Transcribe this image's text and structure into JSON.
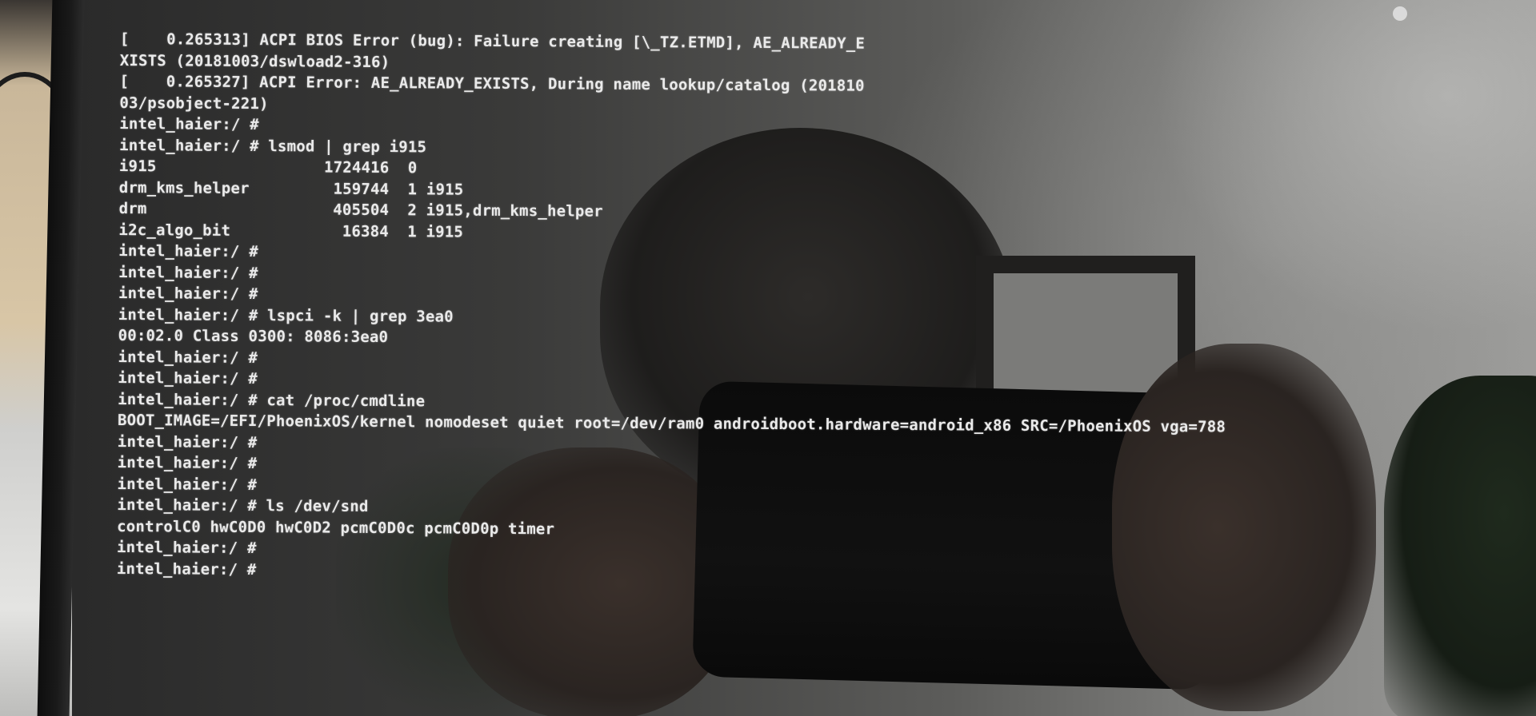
{
  "terminal": {
    "lines": [
      "[    0.265313] ACPI BIOS Error (bug): Failure creating [\\_TZ.ETMD], AE_ALREADY_E",
      "XISTS (20181003/dswload2-316)",
      "[    0.265327] ACPI Error: AE_ALREADY_EXISTS, During name lookup/catalog (201810",
      "03/psobject-221)",
      "intel_haier:/ #",
      "intel_haier:/ # lsmod | grep i915",
      "i915                  1724416  0",
      "drm_kms_helper         159744  1 i915",
      "drm                    405504  2 i915,drm_kms_helper",
      "i2c_algo_bit            16384  1 i915",
      "intel_haier:/ #",
      "intel_haier:/ #",
      "intel_haier:/ #",
      "intel_haier:/ # lspci -k | grep 3ea0",
      "00:02.0 Class 0300: 8086:3ea0",
      "intel_haier:/ #",
      "intel_haier:/ #",
      "intel_haier:/ # cat /proc/cmdline",
      "BOOT_IMAGE=/EFI/PhoenixOS/kernel nomodeset quiet root=/dev/ram0 androidboot.hardware=android_x86 SRC=/PhoenixOS vga=788",
      "intel_haier:/ #",
      "intel_haier:/ #",
      "intel_haier:/ #",
      "intel_haier:/ # ls /dev/snd",
      "controlC0 hwC0D0 hwC0D2 pcmC0D0c pcmC0D0p timer",
      "intel_haier:/ #",
      "intel_haier:/ #"
    ]
  }
}
